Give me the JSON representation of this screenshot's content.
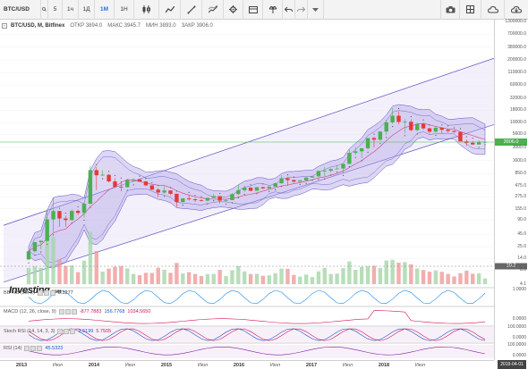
{
  "toolbar": {
    "symbol": "BTC/USD",
    "timeframes": [
      {
        "label": "5",
        "active": false
      },
      {
        "label": "1ч",
        "active": false
      },
      {
        "label": "1Д",
        "active": false
      },
      {
        "label": "1М",
        "active": true
      },
      {
        "label": "1Н",
        "active": false
      }
    ]
  },
  "legend": {
    "pair": "BTC/USD, M, Bitfinex",
    "open": "ОТКР 3894.0",
    "high": "МАКС 3945.7",
    "low": "МИН 3893.0",
    "close": "ЗАКР 3906.0"
  },
  "price_axis": {
    "labels": [
      "1300000.0",
      "700000.0",
      "380000.0",
      "200000.0",
      "110000.0",
      "60000.0",
      "32000.0",
      "18000.0",
      "10000.0",
      "5600.0",
      "3000.0",
      "1600.0",
      "850.0",
      "475.0",
      "275.0",
      "155.0",
      "90.0",
      "45.0",
      "25.0",
      "14.0",
      "8.0",
      "4.1"
    ],
    "last_price": "3906.0",
    "volume_tag": "10.2"
  },
  "logo": {
    "brand": "Investing",
    "suffix": ".com"
  },
  "panels": {
    "bb": {
      "name": "BB %B (20, 2)",
      "v1": "0.3277"
    },
    "macd": {
      "name": "MACD (12, 26, close, 9)",
      "v1": "-877.7883",
      "v2": "156.7768",
      "v3": "1034.5650",
      "axis": "0.0000"
    },
    "stoch": {
      "name": "Stoch RSI (14, 14, 3, 3)",
      "v1": "3.5199",
      "v2": "5.7505",
      "axis_top": "100.0000",
      "axis_bottom": "0.0000"
    },
    "rsi": {
      "name": "RSI (14)",
      "v1": "45.5323",
      "axis_top": "100.0000",
      "axis_bottom": "0.0000"
    }
  },
  "bb_axis": "1.0000",
  "x_axis": {
    "labels": [
      {
        "text": "2013",
        "year": true
      },
      {
        "text": "Июл",
        "year": false
      },
      {
        "text": "2014",
        "year": true
      },
      {
        "text": "Июл",
        "year": false
      },
      {
        "text": "2015",
        "year": true
      },
      {
        "text": "Июл",
        "year": false
      },
      {
        "text": "2016",
        "year": true
      },
      {
        "text": "Июл",
        "year": false
      },
      {
        "text": "2017",
        "year": true
      },
      {
        "text": "Июл",
        "year": false
      },
      {
        "text": "2018",
        "year": true
      },
      {
        "text": "Июл",
        "year": false
      }
    ],
    "current_date": "2019-04-01"
  },
  "colors": {
    "up": "#4caf50",
    "down": "#e53935",
    "band": "#5c4fc4",
    "channel": "#b3a6e6"
  },
  "chart_data": {
    "type": "candlestick",
    "series": [
      {
        "name": "BTC/USD",
        "ohlc": [
          [
            13.5,
            20,
            13,
            20
          ],
          [
            20,
            31,
            19,
            31
          ],
          [
            31,
            34,
            22,
            33
          ],
          [
            33,
            147,
            32,
            93
          ],
          [
            93,
            266,
            50,
            139
          ],
          [
            139,
            140,
            65,
            97
          ],
          [
            97,
            111,
            66,
            90
          ],
          [
            90,
            150,
            88,
            140
          ],
          [
            140,
            150,
            115,
            127
          ],
          [
            127,
            211,
            102,
            198
          ],
          [
            198,
            1242,
            190,
            1000
          ],
          [
            1000,
            1150,
            380,
            780
          ],
          [
            780,
            1000,
            750,
            800
          ],
          [
            800,
            825,
            550,
            580
          ],
          [
            580,
            680,
            420,
            450
          ],
          [
            450,
            600,
            360,
            440
          ],
          [
            440,
            650,
            430,
            620
          ],
          [
            620,
            680,
            560,
            640
          ],
          [
            640,
            660,
            570,
            580
          ],
          [
            580,
            590,
            465,
            480
          ],
          [
            480,
            480,
            380,
            390
          ],
          [
            390,
            420,
            270,
            340
          ],
          [
            340,
            460,
            320,
            375
          ],
          [
            375,
            380,
            300,
            320
          ],
          [
            320,
            320,
            170,
            215
          ],
          [
            215,
            260,
            210,
            255
          ],
          [
            255,
            300,
            230,
            245
          ],
          [
            245,
            260,
            215,
            235
          ],
          [
            235,
            245,
            220,
            230
          ],
          [
            230,
            265,
            220,
            262
          ],
          [
            262,
            316,
            260,
            285
          ],
          [
            285,
            285,
            200,
            230
          ],
          [
            230,
            245,
            220,
            236
          ],
          [
            236,
            330,
            235,
            315
          ],
          [
            315,
            500,
            300,
            380
          ],
          [
            380,
            470,
            350,
            430
          ],
          [
            430,
            435,
            360,
            370
          ],
          [
            370,
            445,
            365,
            440
          ],
          [
            440,
            450,
            400,
            416
          ],
          [
            416,
            470,
            410,
            450
          ],
          [
            450,
            550,
            440,
            530
          ],
          [
            530,
            780,
            520,
            675
          ],
          [
            675,
            700,
            470,
            620
          ],
          [
            620,
            630,
            540,
            575
          ],
          [
            575,
            620,
            570,
            610
          ],
          [
            610,
            710,
            600,
            700
          ],
          [
            700,
            750,
            700,
            740
          ],
          [
            740,
            980,
            730,
            960
          ],
          [
            960,
            1160,
            750,
            970
          ],
          [
            970,
            1090,
            900,
            1050
          ],
          [
            1050,
            1280,
            1040,
            1080
          ],
          [
            1080,
            1350,
            880,
            1350
          ],
          [
            1350,
            2700,
            1350,
            2300
          ],
          [
            2300,
            3000,
            2100,
            2480
          ],
          [
            2480,
            2900,
            1800,
            2870
          ],
          [
            2870,
            4480,
            2700,
            4700
          ],
          [
            4700,
            5000,
            2980,
            4340
          ],
          [
            4340,
            6300,
            4100,
            6450
          ],
          [
            6450,
            11400,
            5500,
            10000
          ],
          [
            10000,
            19800,
            9300,
            13800
          ],
          [
            13800,
            17100,
            9000,
            10200
          ],
          [
            10200,
            11700,
            6000,
            10300
          ],
          [
            10300,
            11600,
            6500,
            6900
          ],
          [
            6900,
            9800,
            6500,
            9250
          ],
          [
            9250,
            9900,
            7000,
            7500
          ],
          [
            7500,
            7700,
            5800,
            6400
          ],
          [
            6400,
            8500,
            6100,
            7700
          ],
          [
            7700,
            7780,
            5900,
            7000
          ],
          [
            7000,
            7400,
            6100,
            6600
          ],
          [
            6600,
            6800,
            6200,
            6300
          ],
          [
            6300,
            6500,
            5200,
            4000
          ],
          [
            4000,
            4400,
            3200,
            3740
          ],
          [
            3740,
            4100,
            3350,
            3450
          ],
          [
            3450,
            4200,
            3400,
            3850
          ],
          [
            3894,
            3945.7,
            3893,
            3906
          ]
        ]
      }
    ],
    "x_range": [
      "2013-01",
      "2019-04"
    ],
    "y_scale": "log",
    "ylim": [
      4.1,
      1300000
    ],
    "indicators": [
      "BB %B (20, 2)",
      "MACD (12, 26, close, 9)",
      "Stoch RSI (14, 14, 3, 3)",
      "RSI (14)"
    ]
  }
}
